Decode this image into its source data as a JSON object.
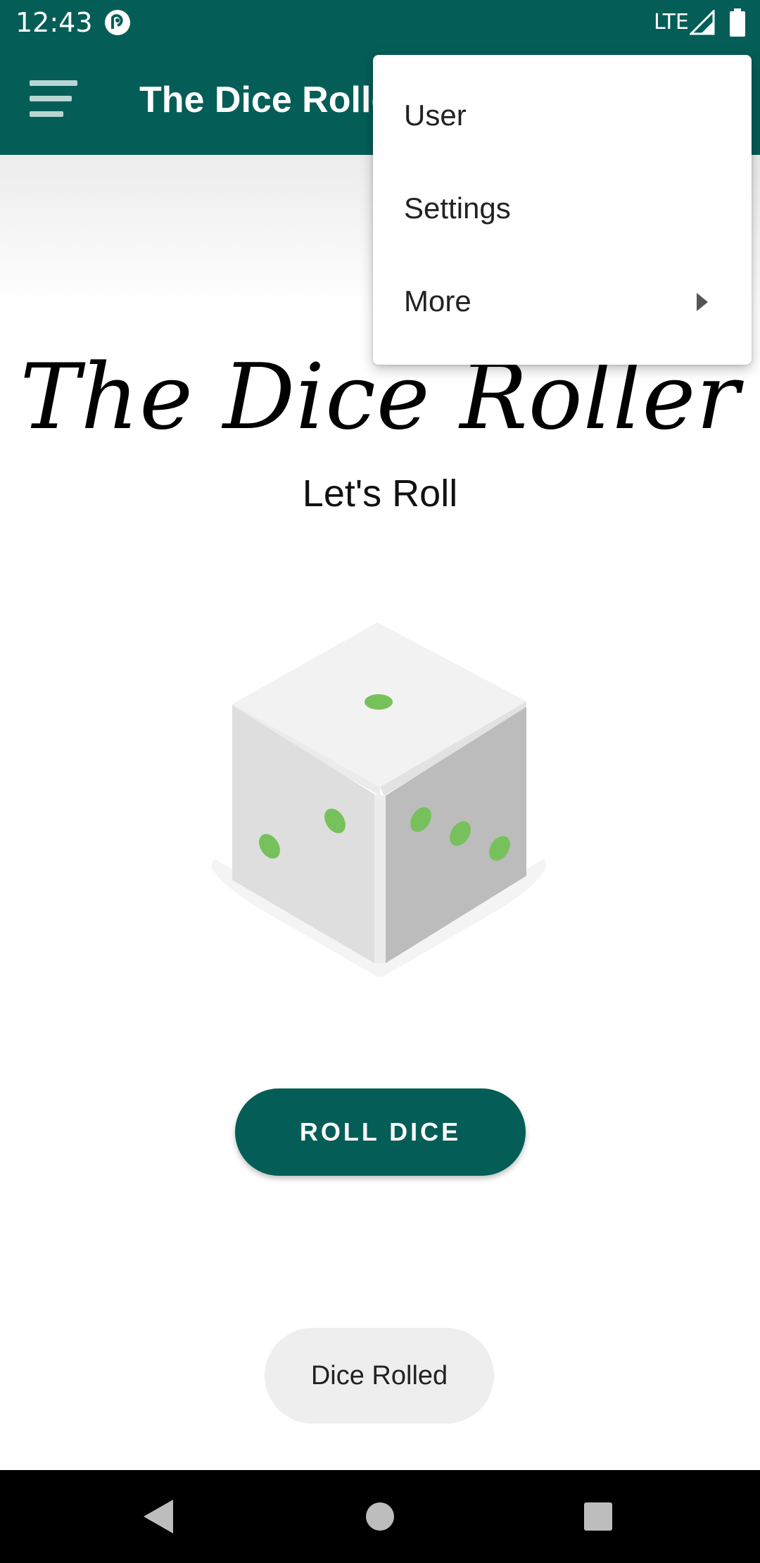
{
  "status_bar": {
    "time": "12:43",
    "network": "LTE",
    "app_icon": "pocket-casts-icon",
    "signal_icon": "signal-icon",
    "battery_icon": "battery-icon"
  },
  "app_bar": {
    "title": "The Dice Roller",
    "menu_icon": "hamburger-menu-icon"
  },
  "overflow_menu": {
    "items": [
      {
        "label": "User"
      },
      {
        "label": "Settings"
      },
      {
        "label": "More",
        "icon": "submenu-arrow-icon"
      }
    ]
  },
  "main": {
    "title": "The Dice Roller",
    "subtitle": "Let's Roll",
    "dice_image": "dice-icon",
    "roll_button_label": "ROLL DICE"
  },
  "toast": {
    "message": "Dice Rolled"
  },
  "nav_bar": {
    "back_icon": "back-icon",
    "home_icon": "home-icon",
    "recents_icon": "recents-icon"
  },
  "colors": {
    "primary": "#045e57",
    "dice_pip": "#76c15b",
    "toast_bg": "#eeeeee"
  }
}
